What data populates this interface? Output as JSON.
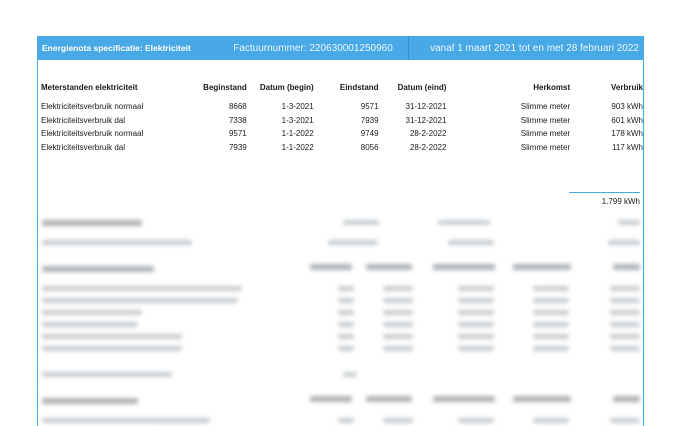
{
  "header": {
    "title": "Energienota specificatie: Elektriciteit",
    "factuurnummer": "Factuurnummer: 220630001250960",
    "period": "vanaf 1 maart 2021 tot en met 28 februari 2022"
  },
  "table": {
    "columns": [
      "Meterstanden elektriciteit",
      "Beginstand",
      "Datum (begin)",
      "Eindstand",
      "Datum (eind)",
      "Herkomst",
      "Verbruik"
    ],
    "rows": [
      [
        "Elektriciteitsverbruik normaal",
        "8668",
        "1-3-2021",
        "9571",
        "31-12-2021",
        "Slimme meter",
        "903 kWh"
      ],
      [
        "Elektriciteitsverbruik dal",
        "7338",
        "1-3-2021",
        "7939",
        "31-12-2021",
        "Slimme meter",
        "601 kWh"
      ],
      [
        "Elektriciteitsverbruik normaal",
        "9571",
        "1-1-2022",
        "9749",
        "28-2-2022",
        "Slimme meter",
        "178 kWh"
      ],
      [
        "Elektriciteitsverbruik dal",
        "7939",
        "1-1-2022",
        "8056",
        "28-2-2022",
        "Slimme meter",
        "117 kWh"
      ]
    ],
    "total": "1.799 kWh"
  }
}
